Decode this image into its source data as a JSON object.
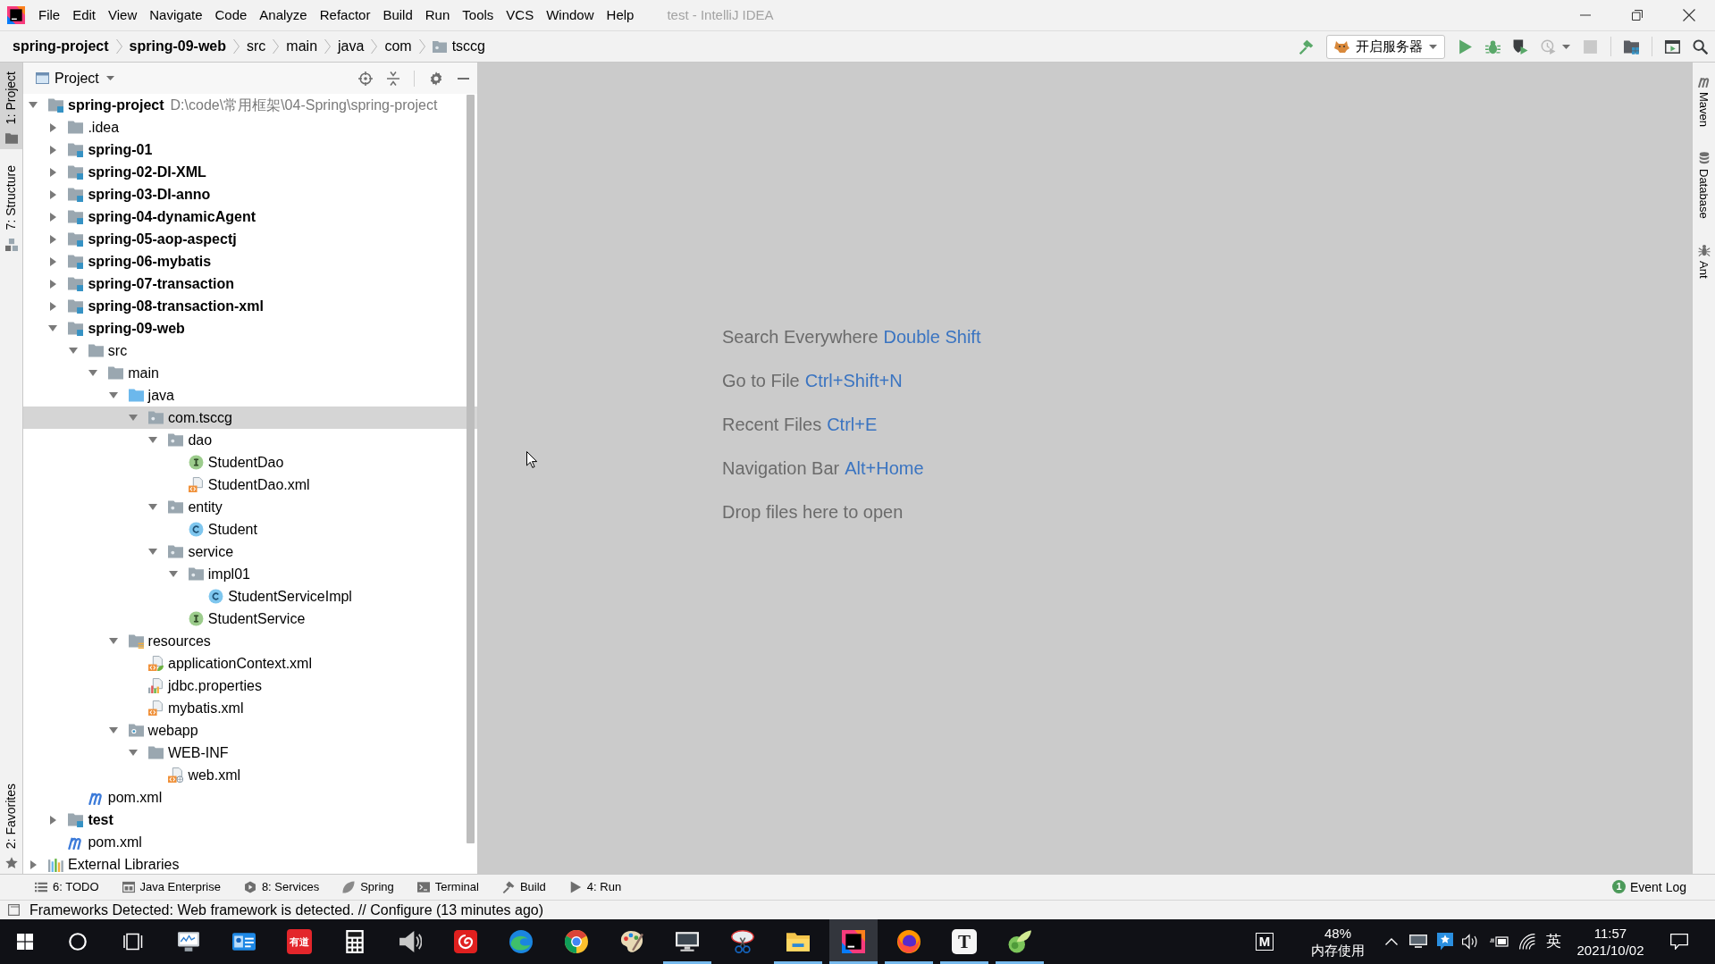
{
  "title_bar": {
    "menu": [
      "File",
      "Edit",
      "View",
      "Navigate",
      "Code",
      "Analyze",
      "Refactor",
      "Build",
      "Run",
      "Tools",
      "VCS",
      "Window",
      "Help"
    ],
    "title": "test - IntelliJ IDEA"
  },
  "breadcrumbs": [
    {
      "label": "spring-project",
      "kind": "module"
    },
    {
      "label": "spring-09-web",
      "kind": "module"
    },
    {
      "label": "src",
      "kind": "folder"
    },
    {
      "label": "main",
      "kind": "folder"
    },
    {
      "label": "java",
      "kind": "folder"
    },
    {
      "label": "com",
      "kind": "folder"
    },
    {
      "label": "tsccg",
      "kind": "package"
    }
  ],
  "toolbar": [
    [
      {
        "kind": "build",
        "disabled": false
      },
      {
        "kind": "run_config",
        "label": "开启服务器"
      },
      {
        "kind": "run",
        "disabled": false
      },
      {
        "kind": "debug",
        "disabled": false
      },
      {
        "kind": "coverage",
        "disabled": false
      },
      {
        "kind": "profile",
        "disabled": true
      },
      {
        "kind": "stop",
        "disabled": true
      }
    ],
    [
      {
        "kind": "structure",
        "disabled": false
      }
    ],
    [
      {
        "kind": "presentation",
        "disabled": false
      },
      {
        "kind": "search",
        "disabled": false
      }
    ]
  ],
  "left_strip": {
    "top": [
      {
        "label": "1: Project",
        "kind": "project",
        "selected": true
      },
      {
        "label": "7: Structure",
        "kind": "structure",
        "selected": false
      }
    ],
    "bottom": [
      {
        "label": "2: Favorites",
        "kind": "favorites",
        "selected": false
      }
    ]
  },
  "project_panel": {
    "title": "Project",
    "tree": [
      {
        "name": "spring-project",
        "kind": "module",
        "location": "D:\\code\\常用框架\\04-Spring\\spring-project",
        "expanded": true,
        "selected": false,
        "children": [
          {
            "name": ".idea",
            "kind": "folder",
            "expanded": false,
            "selected": false
          },
          {
            "name": "spring-01",
            "kind": "module",
            "expanded": false,
            "selected": false
          },
          {
            "name": "spring-02-DI-XML",
            "kind": "module",
            "expanded": false,
            "selected": false
          },
          {
            "name": "spring-03-DI-anno",
            "kind": "module",
            "expanded": false,
            "selected": false
          },
          {
            "name": "spring-04-dynamicAgent",
            "kind": "module",
            "expanded": false,
            "selected": false
          },
          {
            "name": "spring-05-aop-aspectj",
            "kind": "module",
            "expanded": false,
            "selected": false
          },
          {
            "name": "spring-06-mybatis",
            "kind": "module",
            "expanded": false,
            "selected": false
          },
          {
            "name": "spring-07-transaction",
            "kind": "module",
            "expanded": false,
            "selected": false
          },
          {
            "name": "spring-08-transaction-xml",
            "kind": "module",
            "expanded": false,
            "selected": false
          },
          {
            "name": "spring-09-web",
            "kind": "module",
            "expanded": true,
            "selected": false,
            "children": [
              {
                "name": "src",
                "kind": "folder",
                "expanded": true,
                "selected": false,
                "children": [
                  {
                    "name": "main",
                    "kind": "folder",
                    "expanded": true,
                    "selected": false,
                    "children": [
                      {
                        "name": "java",
                        "kind": "source",
                        "expanded": true,
                        "selected": false,
                        "children": [
                          {
                            "name": "com.tsccg",
                            "kind": "package",
                            "expanded": true,
                            "selected": true,
                            "children": [
                              {
                                "name": "dao",
                                "kind": "package",
                                "expanded": true,
                                "selected": false,
                                "children": [
                                  {
                                    "name": "StudentDao",
                                    "kind": "interface",
                                    "selected": false
                                  },
                                  {
                                    "name": "StudentDao.xml",
                                    "kind": "xml",
                                    "selected": false
                                  }
                                ]
                              },
                              {
                                "name": "entity",
                                "kind": "package",
                                "expanded": true,
                                "selected": false,
                                "children": [
                                  {
                                    "name": "Student",
                                    "kind": "class",
                                    "selected": false
                                  }
                                ]
                              },
                              {
                                "name": "service",
                                "kind": "package",
                                "expanded": true,
                                "selected": false,
                                "children": [
                                  {
                                    "name": "impl01",
                                    "kind": "package",
                                    "expanded": true,
                                    "selected": false,
                                    "children": [
                                      {
                                        "name": "StudentServiceImpl",
                                        "kind": "class",
                                        "selected": false
                                      }
                                    ]
                                  },
                                  {
                                    "name": "StudentService",
                                    "kind": "interface",
                                    "selected": false
                                  }
                                ]
                              }
                            ]
                          }
                        ]
                      },
                      {
                        "name": "resources",
                        "kind": "resources",
                        "expanded": true,
                        "selected": false,
                        "children": [
                          {
                            "name": "applicationContext.xml",
                            "kind": "spring_xml",
                            "selected": false
                          },
                          {
                            "name": "jdbc.properties",
                            "kind": "properties",
                            "selected": false
                          },
                          {
                            "name": "mybatis.xml",
                            "kind": "xml",
                            "selected": false
                          }
                        ]
                      },
                      {
                        "name": "webapp",
                        "kind": "web",
                        "expanded": true,
                        "selected": false,
                        "children": [
                          {
                            "name": "WEB-INF",
                            "kind": "folder",
                            "expanded": true,
                            "selected": false,
                            "children": [
                              {
                                "name": "web.xml",
                                "kind": "web_xml",
                                "selected": false
                              }
                            ]
                          }
                        ]
                      }
                    ]
                  }
                ]
              },
              {
                "name": "pom.xml",
                "kind": "maven",
                "selected": false
              }
            ]
          },
          {
            "name": "test",
            "kind": "module",
            "expanded": false,
            "selected": false
          },
          {
            "name": "pom.xml",
            "kind": "maven",
            "selected": false
          }
        ]
      },
      {
        "name": "External Libraries",
        "kind": "libraries",
        "expanded": false,
        "selected": false
      }
    ]
  },
  "editor_hints": [
    {
      "text": "Search Everywhere",
      "shortcut": "Double Shift"
    },
    {
      "text": "Go to File",
      "shortcut": "Ctrl+Shift+N"
    },
    {
      "text": "Recent Files",
      "shortcut": "Ctrl+E"
    },
    {
      "text": "Navigation Bar",
      "shortcut": "Alt+Home"
    },
    {
      "text": "Drop files here to open"
    }
  ],
  "right_strip": [
    {
      "label": "Maven",
      "kind": "maven",
      "selected": false
    },
    {
      "label": "Database",
      "kind": "database",
      "selected": false
    },
    {
      "label": "Ant",
      "kind": "ant",
      "selected": false
    }
  ],
  "tool_window_bar": {
    "tabs": [
      {
        "label": "6: TODO",
        "kind": "todo",
        "selected": false
      },
      {
        "label": "Java Enterprise",
        "kind": "java_enterprise",
        "selected": false
      },
      {
        "label": "8: Services",
        "kind": "services",
        "selected": false
      },
      {
        "label": "Spring",
        "kind": "spring",
        "selected": false
      },
      {
        "label": "Terminal",
        "kind": "terminal",
        "selected": false
      },
      {
        "label": "Build",
        "kind": "build",
        "selected": false
      },
      {
        "label": "4: Run",
        "kind": "run",
        "selected": false
      }
    ],
    "event_log": {
      "label": "Event Log",
      "badge": "1"
    }
  },
  "status_bar": {
    "message": "Frameworks Detected: Web framework is detected. // Configure (13 minutes ago)"
  },
  "taskbar": {
    "apps": [
      {
        "kind": "monitor_graph",
        "running": false,
        "selected": false
      },
      {
        "kind": "card",
        "running": false,
        "selected": false
      },
      {
        "kind": "dict",
        "text": "有道",
        "running": false,
        "selected": false
      },
      {
        "kind": "calculator",
        "running": false,
        "selected": false
      },
      {
        "kind": "speaker",
        "running": false,
        "selected": false
      },
      {
        "kind": "spiral",
        "running": false,
        "selected": false
      },
      {
        "kind": "edge",
        "running": false,
        "selected": false
      },
      {
        "kind": "chrome",
        "running": false,
        "selected": false
      },
      {
        "kind": "palette",
        "running": false,
        "selected": false
      },
      {
        "kind": "monitor",
        "running": true,
        "selected": false
      },
      {
        "kind": "scissors",
        "running": false,
        "selected": false
      },
      {
        "kind": "explorer",
        "running": true,
        "selected": false
      },
      {
        "kind": "intellij",
        "running": true,
        "selected": true
      },
      {
        "kind": "firefox",
        "running": true,
        "selected": false
      },
      {
        "kind": "typora",
        "text": "T",
        "running": true,
        "selected": false
      },
      {
        "kind": "leaf",
        "running": true,
        "selected": false
      }
    ],
    "tray": {
      "app_badge": "M",
      "memory_percent": "48%",
      "memory_label": "内存使用",
      "input_method": "英",
      "time": "11:57",
      "date": "2021/10/02"
    }
  }
}
